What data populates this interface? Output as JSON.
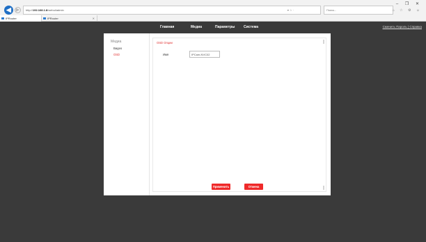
{
  "browser": {
    "address_prefix": "http://",
    "address_host": "192.168.1.8",
    "address_path": "/webui/admin",
    "address_actions": "▾ ☆ ·",
    "search_placeholder": "Поиск...",
    "window_controls": "– ❐ ✕",
    "toolbar_icons": "⌂ ☆ ⚙ ☺",
    "tabs": [
      {
        "label": "IPRouter"
      },
      {
        "label": "IPRouter"
      }
    ]
  },
  "nav": {
    "items": [
      "Главная",
      "Медиа",
      "Параметры",
      "Система"
    ],
    "right_link": "Сменить Пароль | Справка"
  },
  "sidebar": {
    "title": "Медиа",
    "items": [
      {
        "label": "Видео",
        "active": false
      },
      {
        "label": "OSD",
        "active": true
      }
    ]
  },
  "content": {
    "section_title": "OSD Опции",
    "field_label": "Имя",
    "field_value": "IPCam-NVC02"
  },
  "buttons": {
    "apply": "Применить",
    "cancel": "Отмена"
  },
  "colors": {
    "accent": "#ef2a2a",
    "background": "#3a3a3a",
    "card": "#ffffff"
  }
}
